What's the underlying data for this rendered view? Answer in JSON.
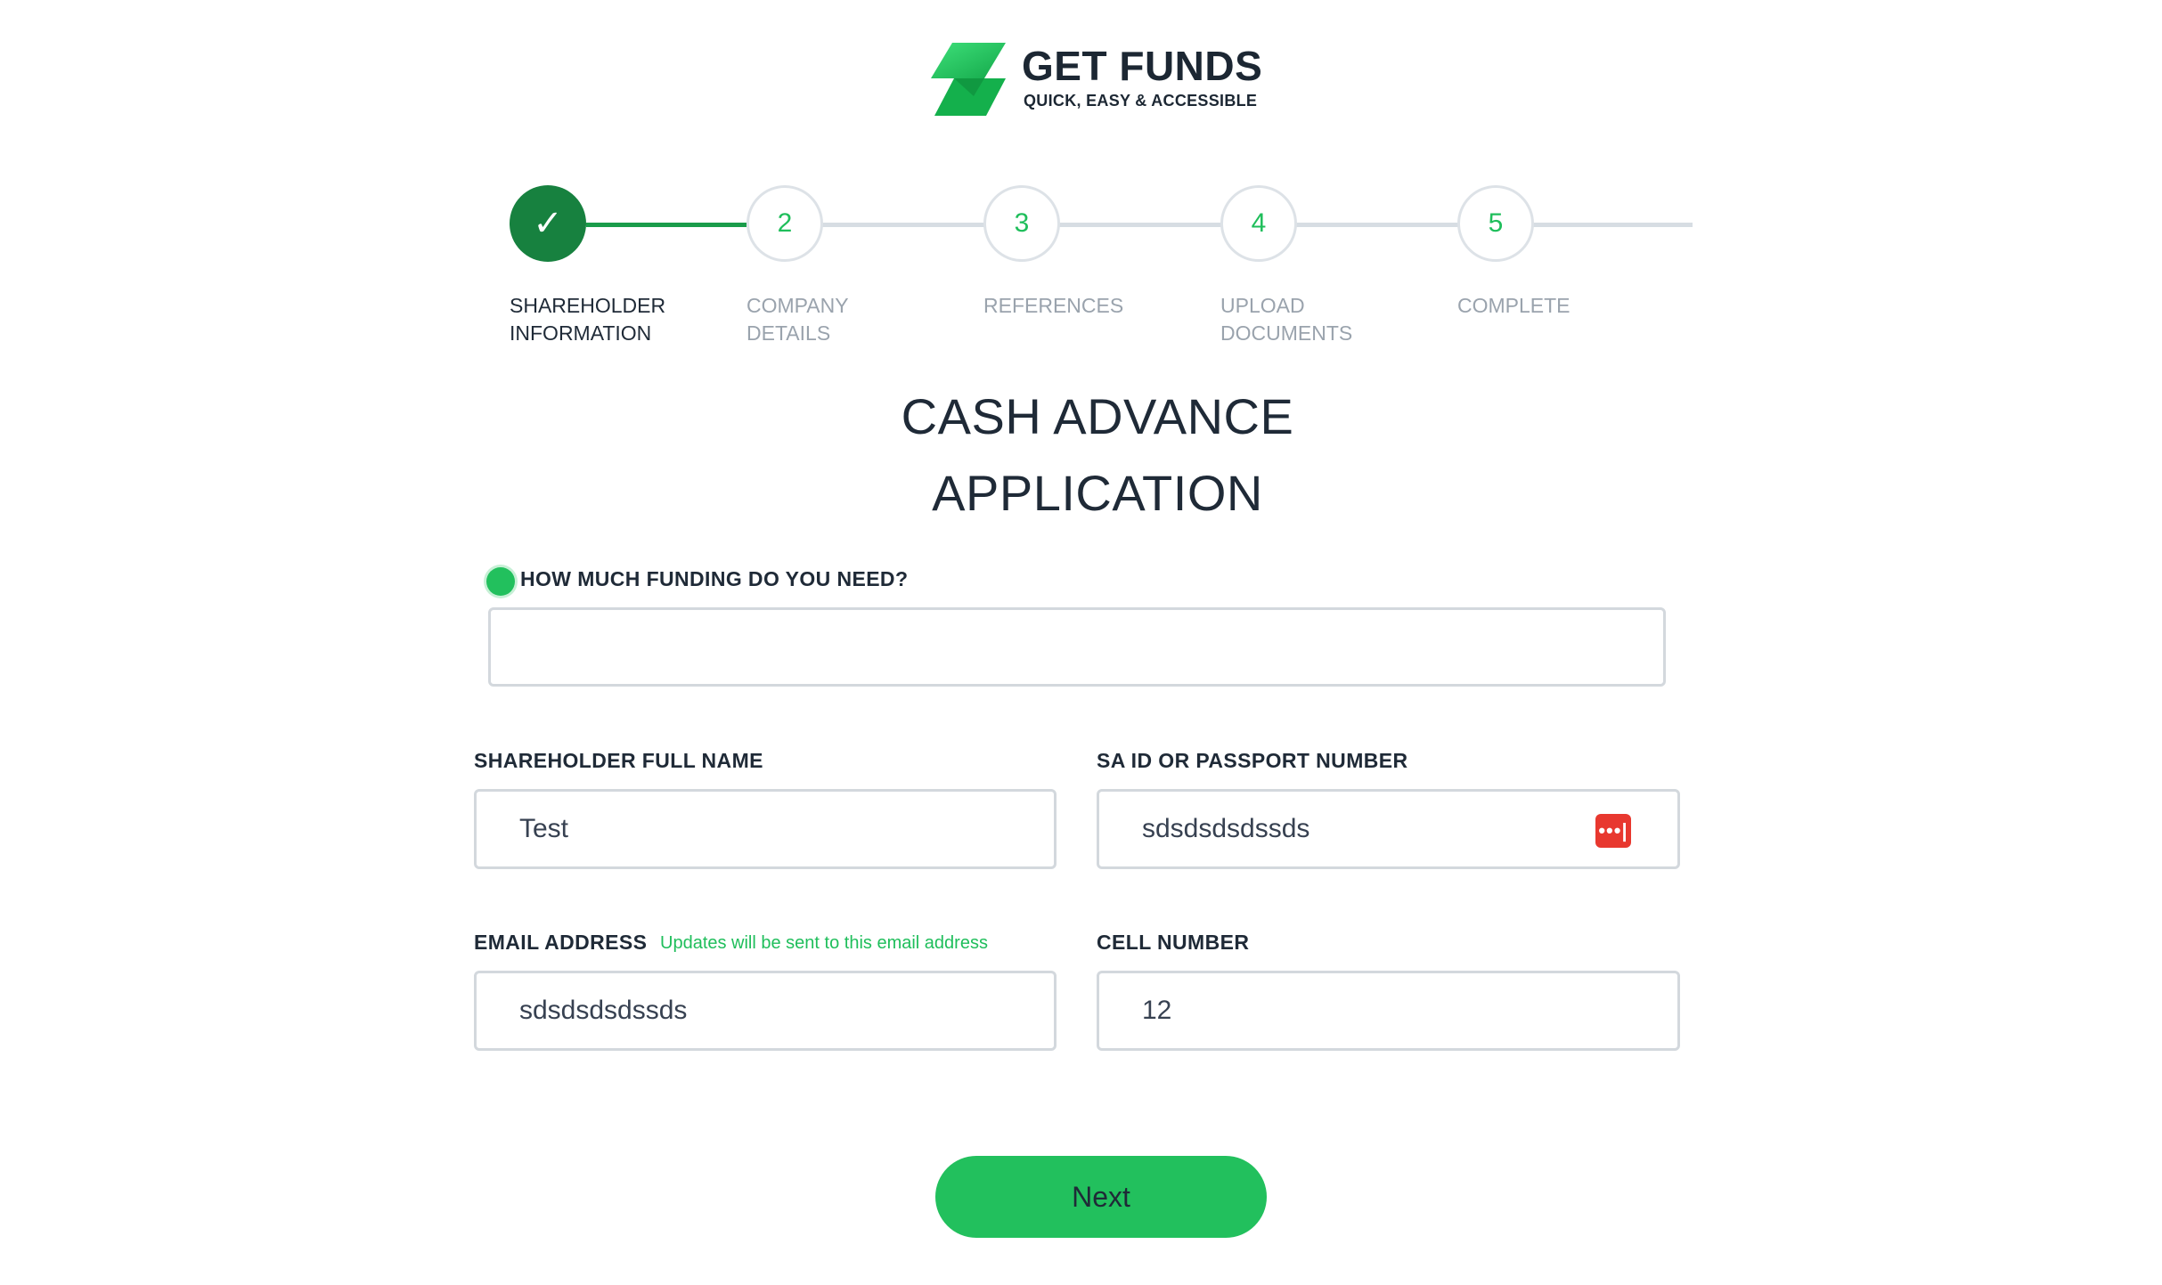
{
  "brand": {
    "name": "GET FUNDS",
    "tagline": "QUICK, EASY & ACCESSIBLE",
    "accent": "#22c05d",
    "dark_accent": "#17813f"
  },
  "stepper": {
    "steps": [
      {
        "marker": "✓",
        "label_line1": "SHAREHOLDER",
        "label_line2": "INFORMATION",
        "state": "complete"
      },
      {
        "marker": "2",
        "label_line1": "COMPANY",
        "label_line2": "DETAILS",
        "state": "upcoming"
      },
      {
        "marker": "3",
        "label_line1": "REFERENCES",
        "label_line2": "",
        "state": "upcoming"
      },
      {
        "marker": "4",
        "label_line1": "UPLOAD",
        "label_line2": "DOCUMENTS",
        "state": "upcoming"
      },
      {
        "marker": "5",
        "label_line1": "COMPLETE",
        "label_line2": "",
        "state": "upcoming"
      }
    ]
  },
  "title": {
    "line1": "CASH ADVANCE",
    "line2": "APPLICATION"
  },
  "form": {
    "funding": {
      "label": "HOW MUCH FUNDING DO YOU NEED?",
      "value": ""
    },
    "full_name": {
      "label": "SHAREHOLDER FULL NAME",
      "value": "Test"
    },
    "id_number": {
      "label": "SA ID OR PASSPORT NUMBER",
      "value": "sdsdsdsdssds",
      "badge": "•••|",
      "badge_icon": "password-manager-icon"
    },
    "email": {
      "label": "EMAIL ADDRESS",
      "hint": "Updates will be sent to this email address",
      "value": "sdsdsdsdssds"
    },
    "cell": {
      "label": "CELL NUMBER",
      "value": "12"
    },
    "next_label": "Next"
  }
}
